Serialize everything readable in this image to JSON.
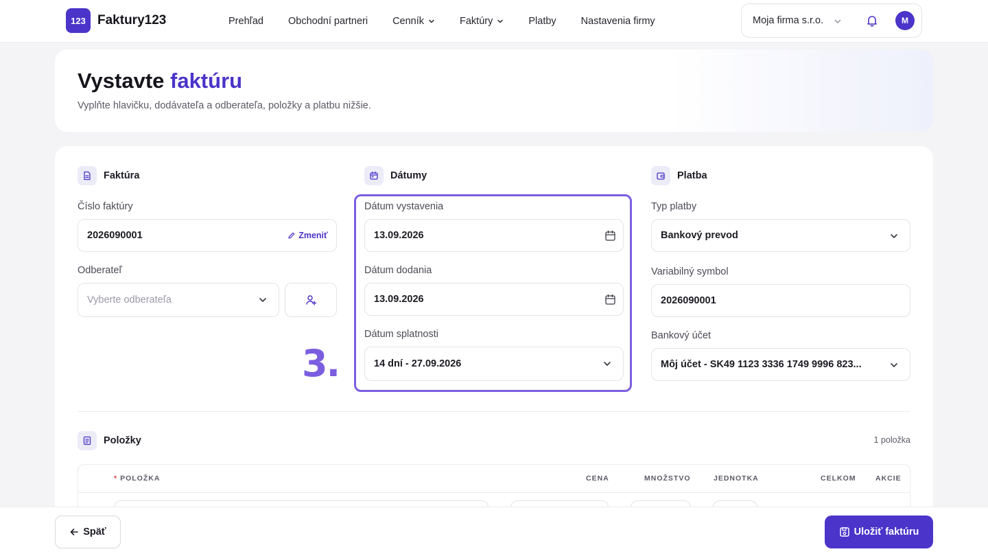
{
  "app": {
    "logo_badge": "123",
    "name": "Faktury123"
  },
  "nav": {
    "items": [
      {
        "label": "Prehľad",
        "dropdown": false
      },
      {
        "label": "Obchodní partneri",
        "dropdown": false
      },
      {
        "label": "Cenník",
        "dropdown": true
      },
      {
        "label": "Faktúry",
        "dropdown": true
      },
      {
        "label": "Platby",
        "dropdown": false
      },
      {
        "label": "Nastavenia firmy",
        "dropdown": false
      }
    ]
  },
  "account": {
    "company": "Moja firma s.r.o.",
    "avatar_initial": "M"
  },
  "hero": {
    "title_plain": "Vystavte ",
    "title_accent": "faktúru",
    "subtitle": "Vyplňte hlavičku, dodávateľa a odberateľa, položky a platbu nižšie."
  },
  "invoice": {
    "section_title": "Faktúra",
    "number_label": "Číslo faktúry",
    "number_value": "2026090001",
    "change_label": "Zmeniť",
    "customer_label": "Odberateľ",
    "customer_placeholder": "Vyberte odberateľa"
  },
  "dates": {
    "section_title": "Dátumy",
    "issue_label": "Dátum vystavenia",
    "issue_value": "13.09.2026",
    "delivery_label": "Dátum dodania",
    "delivery_value": "13.09.2026",
    "due_label": "Dátum splatnosti",
    "due_value": "14 dní - 27.09.2026"
  },
  "step_marker": "3.",
  "payment": {
    "section_title": "Platba",
    "type_label": "Typ platby",
    "type_value": "Bankový prevod",
    "variable_symbol_label": "Variabilný symbol",
    "variable_symbol_value": "2026090001",
    "bank_account_label": "Bankový účet",
    "bank_account_value": "Môj účet - SK49 1123 3336 1749 9996 823..."
  },
  "items": {
    "section_title": "Položky",
    "count": "1 položka",
    "columns": {
      "item": "POLOŽKA",
      "price": "CENA",
      "quantity": "MNOŽSTVO",
      "unit": "JEDNOTKA",
      "total": "CELKOM",
      "actions": "AKCIE"
    }
  },
  "footer": {
    "back_label": "Späť",
    "save_label": "Uložiť faktúru"
  },
  "colors": {
    "accent": "#4a34c9",
    "highlight": "#7b5ee0",
    "required": "#d93a3a"
  }
}
